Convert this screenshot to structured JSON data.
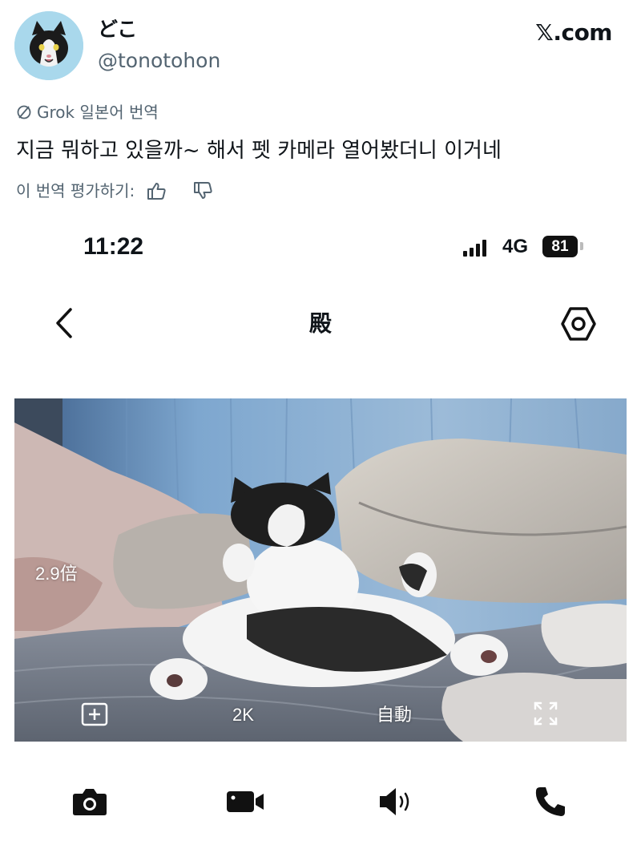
{
  "tweet": {
    "display_name": "どこ",
    "handle": "@tonotohon",
    "site": "𝕏.com",
    "translation_label": "Grok 일본어 번역",
    "text": "지금 뭐하고 있을까~ 해서 펫 카메라 열어봤더니 이거네",
    "rate_prompt": "이 번역 평가하기:"
  },
  "phone_status": {
    "time": "11:22",
    "network": "4G",
    "battery": "81"
  },
  "camera_app": {
    "title": "殿",
    "zoom": "2.9倍",
    "quality": "2K",
    "mode": "自動"
  },
  "icons": {
    "avatar": "cat-avatar",
    "translate": "slashed-circle-icon",
    "thumbs_up": "thumbs-up-icon",
    "thumbs_down": "thumbs-down-icon",
    "back": "chevron-left-icon",
    "settings": "hexagon-settings-icon",
    "add": "plus-square-icon",
    "fullscreen": "expand-icon",
    "camera": "camera-icon",
    "video": "video-camera-icon",
    "speaker": "speaker-icon",
    "phone": "phone-icon"
  }
}
